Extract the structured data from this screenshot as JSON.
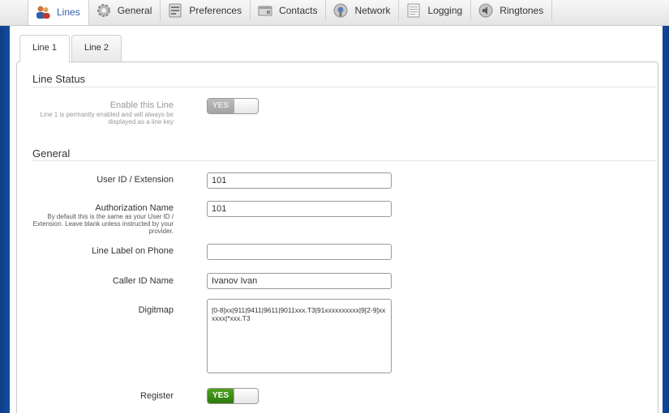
{
  "top_tabs": [
    {
      "label": "Lines",
      "icon": "users-icon"
    },
    {
      "label": "General",
      "icon": "gear-icon"
    },
    {
      "label": "Preferences",
      "icon": "preferences-icon"
    },
    {
      "label": "Contacts",
      "icon": "contacts-icon"
    },
    {
      "label": "Network",
      "icon": "network-icon"
    },
    {
      "label": "Logging",
      "icon": "logging-icon"
    },
    {
      "label": "Ringtones",
      "icon": "speaker-icon"
    }
  ],
  "line_tabs": [
    "Line 1",
    "Line 2"
  ],
  "line_status": {
    "title": "Line Status",
    "enable_label": "Enable this Line",
    "enable_hint": "Line 1 is permantly enabled and will always be displayed as a line key",
    "enable_toggle": "YES"
  },
  "general": {
    "title": "General",
    "user_id_label": "User ID / Extension",
    "user_id_value": "101",
    "auth_name_label": "Authorization Name",
    "auth_name_hint": "By default this is the same as your User ID / Extension. Leave blank unless instructed by your provider.",
    "auth_name_value": "101",
    "line_label_label": "Line Label on Phone",
    "line_label_value": "",
    "caller_id_label": "Caller ID Name",
    "caller_id_value": "Ivanov Ivan",
    "digitmap_label": "Digitmap",
    "digitmap_value": "[0-8]xx|911|9411|9611|9011xxx.T3|91xxxxxxxxxx|9[2-9]xxxxxx|*xxx.T3",
    "register_label": "Register",
    "register_toggle": "YES"
  },
  "colors": {
    "accent_tab_text": "#2f5fa8",
    "toggle_on": "#3a8a14",
    "background_blue": "#1a5bb8"
  }
}
